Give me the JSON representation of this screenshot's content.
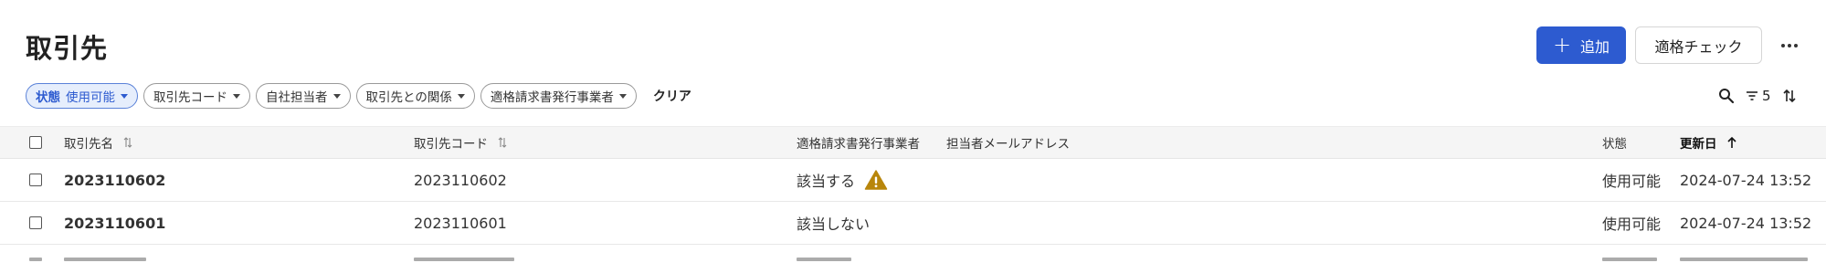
{
  "page": {
    "title": "取引先"
  },
  "toolbar": {
    "add_label": "追加",
    "check_label": "適格チェック",
    "more_icon": "more-horizontal-icon"
  },
  "filters": {
    "status_label": "状態",
    "status_value": "使用可能",
    "chips": [
      "取引先コード",
      "自社担当者",
      "取引先との関係",
      "適格請求書発行事業者"
    ],
    "clear_label": "クリア"
  },
  "tools": {
    "filter_count": "5"
  },
  "table": {
    "headers": {
      "name": "取引先名",
      "code": "取引先コード",
      "qualified": "適格請求書発行事業者",
      "email": "担当者メールアドレス",
      "status": "状態",
      "updated": "更新日"
    },
    "rows": [
      {
        "name": "2023110602",
        "code": "2023110602",
        "qualified": "該当する",
        "warning": true,
        "status": "使用可能",
        "updated": "2024-07-24 13:52"
      },
      {
        "name": "2023110601",
        "code": "2023110601",
        "qualified": "該当しない",
        "warning": false,
        "status": "使用可能",
        "updated": "2024-07-24 13:52"
      }
    ]
  },
  "colors": {
    "accent": "#2d5bd0",
    "warning": "#b8860b"
  }
}
